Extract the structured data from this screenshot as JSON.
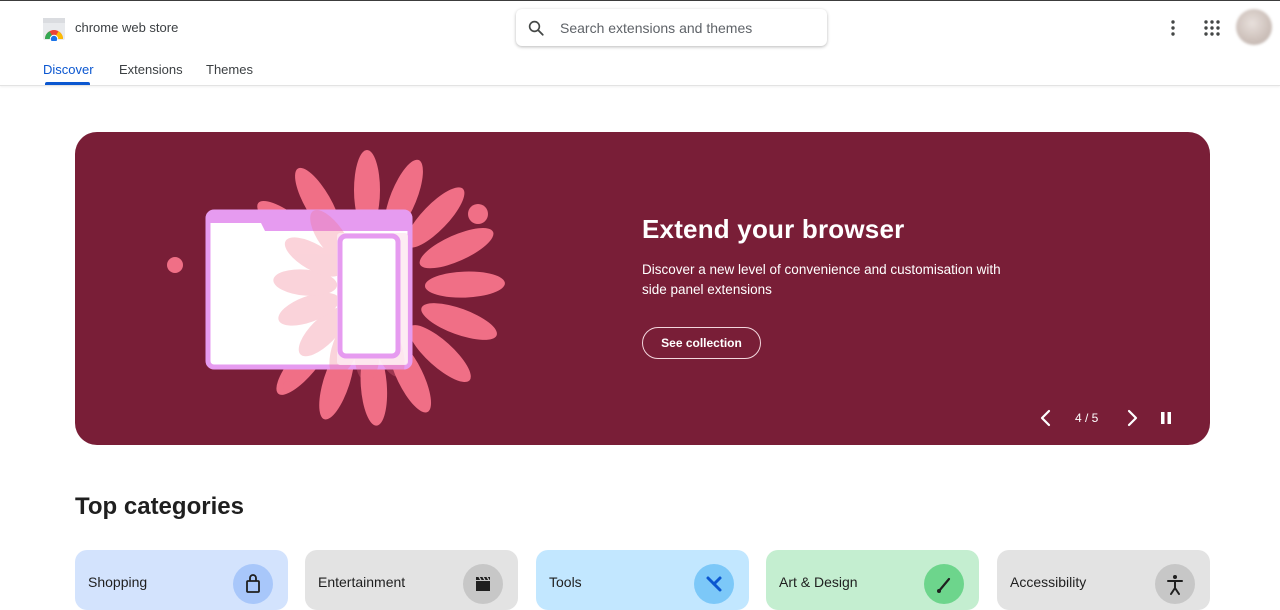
{
  "header": {
    "brand": "chrome web store",
    "search_placeholder": "Search extensions and themes"
  },
  "tabs": [
    {
      "label": "Discover",
      "active": true
    },
    {
      "label": "Extensions",
      "active": false
    },
    {
      "label": "Themes",
      "active": false
    }
  ],
  "hero": {
    "title": "Extend your browser",
    "description": "Discover a new level of convenience and customisation with side panel extensions",
    "button_label": "See collection",
    "counter": "4 / 5",
    "background_color": "#791e37"
  },
  "top_categories": {
    "title": "Top categories",
    "items": [
      {
        "label": "Shopping",
        "icon": "shopping-bag-icon",
        "bg": "#d3e3fd",
        "icon_bg": "#a8c7fa"
      },
      {
        "label": "Entertainment",
        "icon": "clapperboard-icon",
        "bg": "#e3e3e3",
        "icon_bg": "#c7c7c7"
      },
      {
        "label": "Tools",
        "icon": "tools-icon",
        "bg": "#c2e7ff",
        "icon_bg": "#7cc8f8"
      },
      {
        "label": "Art & Design",
        "icon": "brush-icon",
        "bg": "#c4eed0",
        "icon_bg": "#6dd58c"
      },
      {
        "label": "Accessibility",
        "icon": "accessibility-icon",
        "bg": "#e3e3e3",
        "icon_bg": "#c7c7c7"
      }
    ]
  }
}
